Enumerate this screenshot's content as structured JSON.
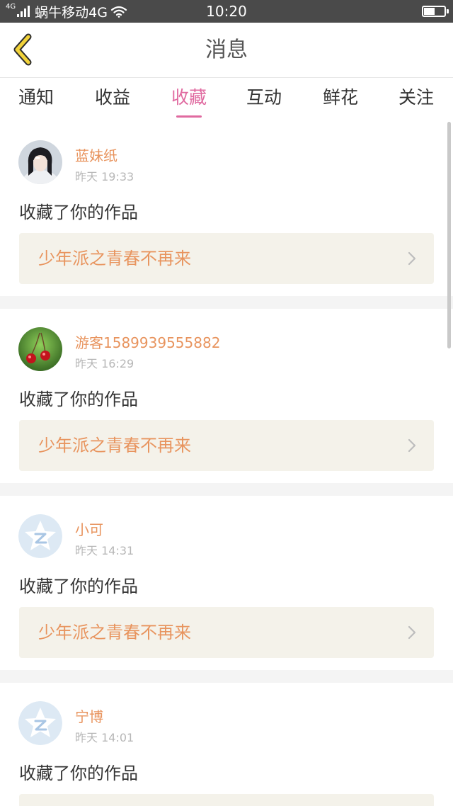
{
  "status_bar": {
    "network_tag": "4G",
    "carrier": "蜗牛移动4G",
    "time": "10:20",
    "icons": [
      "signal-icon",
      "wifi-icon",
      "battery-icon"
    ]
  },
  "header": {
    "back_icon": "chevron-left-icon",
    "title": "消息"
  },
  "tabs": [
    {
      "label": "通知",
      "active": false
    },
    {
      "label": "收益",
      "active": false
    },
    {
      "label": "收藏",
      "active": true
    },
    {
      "label": "互动",
      "active": false
    },
    {
      "label": "鲜花",
      "active": false
    },
    {
      "label": "关注",
      "active": false
    }
  ],
  "items": [
    {
      "username": "蓝妹纸",
      "time": "昨天 19:33",
      "action": "收藏了你的作品",
      "work_title": "少年派之青春不再来",
      "avatar": "photo-girl-avatar"
    },
    {
      "username": "游客1589939555882",
      "time": "昨天 16:29",
      "action": "收藏了你的作品",
      "work_title": "少年派之青春不再来",
      "avatar": "cherry-avatar"
    },
    {
      "username": "小可",
      "time": "昨天 14:31",
      "action": "收藏了你的作品",
      "work_title": "少年派之青春不再来",
      "avatar": "default-star-avatar"
    },
    {
      "username": "宁博",
      "time": "昨天 14:01",
      "action": "收藏了你的作品",
      "work_title": "",
      "avatar": "default-star-avatar"
    }
  ],
  "colors": {
    "accent": "#e06aa0",
    "name_orange": "#e8945e",
    "back_icon_yellow": "#f2d33a",
    "status_bar_bg": "#4a4a4a",
    "work_box_bg": "#f4f2ea"
  }
}
